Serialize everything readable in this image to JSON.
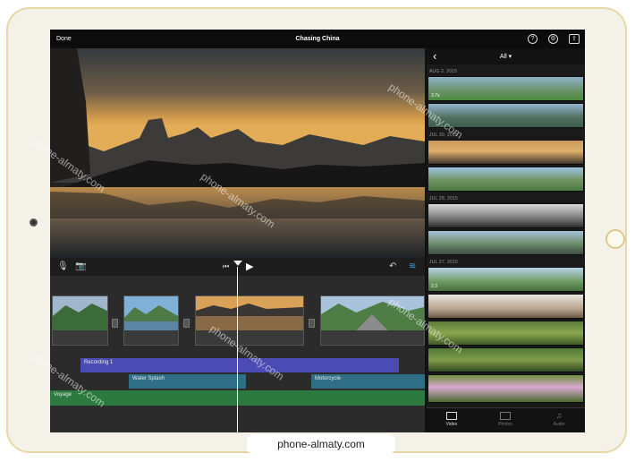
{
  "topbar": {
    "done_label": "Done",
    "project_title": "Chasing China",
    "help_icon": "question-circle-icon",
    "settings_icon": "gear-icon",
    "export_icon": "share-box-icon"
  },
  "controls": {
    "mic_icon": "microphone-icon",
    "camera_icon": "camera-icon",
    "skip_back_icon": "skip-to-start-icon",
    "play_icon": "play-icon",
    "undo_icon": "undo-icon",
    "audio_icon": "waveform-icon"
  },
  "timeline": {
    "audio_tracks": [
      {
        "label": "Recording 1",
        "color": "#4a4cb3"
      },
      {
        "label": "Water Splash",
        "color": "#2f6e86"
      },
      {
        "label": "Motorcycle",
        "color": "#2f6e86"
      },
      {
        "label": "Voyage",
        "color": "#2c7a3f"
      }
    ]
  },
  "browser": {
    "back_icon": "chevron-left-icon",
    "filter_label": "All",
    "sections": [
      {
        "date": "AUG 2, 2015",
        "badges": [
          "3.7s",
          ""
        ]
      },
      {
        "date": "JUL 30, 2015",
        "badges": [
          "",
          ""
        ]
      },
      {
        "date": "JUL 28, 2015",
        "badges": [
          "",
          ""
        ]
      },
      {
        "date": "JUL 27, 2015",
        "badges": [
          "2.3",
          "",
          "",
          "",
          ""
        ]
      }
    ],
    "tabs": [
      {
        "label": "Video",
        "icon": "film-icon",
        "active": true
      },
      {
        "label": "Photos",
        "icon": "photo-icon",
        "active": false
      },
      {
        "label": "Audio",
        "icon": "music-note-icon",
        "active": false
      }
    ]
  },
  "watermark_text": "phone-almaty.com"
}
